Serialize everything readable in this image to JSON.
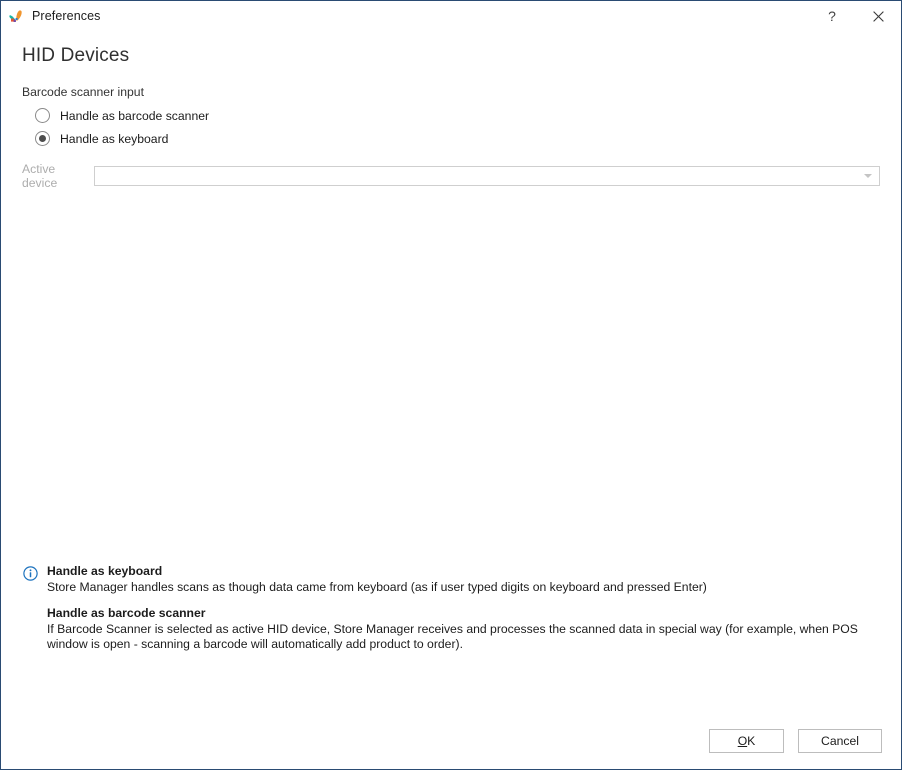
{
  "window": {
    "title": "Preferences",
    "app_icon": "butterfly-logo-icon",
    "border_color": "#2a4b73",
    "help_label": "?",
    "close_label": "✕"
  },
  "page": {
    "heading": "HID Devices"
  },
  "barcode_group": {
    "label": "Barcode scanner input",
    "options": [
      {
        "label": "Handle as barcode scanner",
        "selected": false
      },
      {
        "label": "Handle as keyboard",
        "selected": true
      }
    ]
  },
  "active_device": {
    "label": "Active device",
    "value": "",
    "placeholder": "",
    "disabled": true,
    "arrow_icon": "chevron-down-icon"
  },
  "info": {
    "icon": "info-circle-icon",
    "icon_color": "#1e73be",
    "entries": [
      {
        "title": "Handle as keyboard",
        "body": "Store Manager handles scans as though data came from keyboard (as if user typed digits on keyboard and pressed Enter)"
      },
      {
        "title": "Handle as barcode scanner",
        "body": "If Barcode Scanner is selected as active HID device, Store Manager receives and processes the scanned data in special way (for example, when POS window is open - scanning a barcode will automatically add product to order)."
      }
    ]
  },
  "footer": {
    "ok_accel": "O",
    "ok_rest": "K",
    "cancel_label": "Cancel"
  }
}
